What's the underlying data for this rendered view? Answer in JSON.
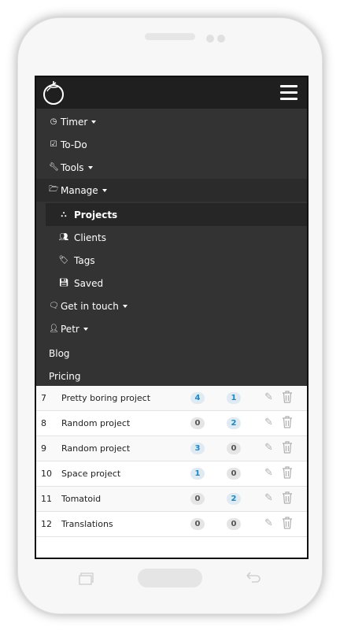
{
  "nav": {
    "timer": "Timer",
    "todo": "To-Do",
    "tools": "Tools",
    "manage": "Manage",
    "manage_items": [
      "Projects",
      "Clients",
      "Tags",
      "Saved"
    ],
    "get_in_touch": "Get in touch",
    "user": "Petr",
    "blog": "Blog",
    "pricing": "Pricing"
  },
  "projects": [
    {
      "num": "7",
      "name": "Pretty boring project",
      "a": "4",
      "b": "1"
    },
    {
      "num": "8",
      "name": "Random project",
      "a": "0",
      "b": "2"
    },
    {
      "num": "9",
      "name": "Random project",
      "a": "3",
      "b": "0"
    },
    {
      "num": "10",
      "name": "Space project",
      "a": "1",
      "b": "0"
    },
    {
      "num": "11",
      "name": "Tomatoid",
      "a": "0",
      "b": "2"
    },
    {
      "num": "12",
      "name": "Translations",
      "a": "0",
      "b": "0"
    }
  ],
  "colors": {
    "navbar": "#1f1f1f",
    "menu": "#333333",
    "badge_blue": "#1a8ac6",
    "badge_grey": "#555555"
  }
}
